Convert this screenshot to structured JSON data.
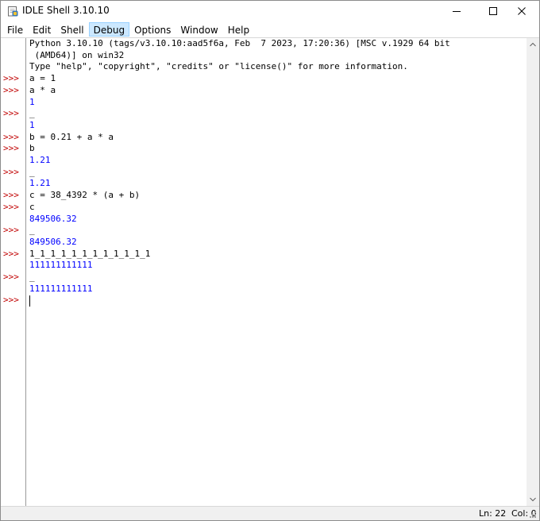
{
  "window": {
    "title": "IDLE Shell 3.10.10",
    "minimize_icon": "minimize-icon",
    "maximize_icon": "maximize-icon",
    "close_icon": "close-icon"
  },
  "menu": {
    "items": [
      {
        "label": "File"
      },
      {
        "label": "Edit"
      },
      {
        "label": "Shell"
      },
      {
        "label": "Debug"
      },
      {
        "label": "Options"
      },
      {
        "label": "Window"
      },
      {
        "label": "Help"
      }
    ],
    "active": "Debug"
  },
  "shell": {
    "prompt": ">>>",
    "banner": [
      "Python 3.10.10 (tags/v3.10.10:aad5f6a, Feb  7 2023, 17:20:36) [MSC v.1929 64 bit",
      " (AMD64)] on win32",
      "Type \"help\", \"copyright\", \"credits\" or \"license()\" for more information."
    ],
    "lines": [
      {
        "kind": "in",
        "text": "a = 1"
      },
      {
        "kind": "in",
        "text": "a * a"
      },
      {
        "kind": "out",
        "text": "1"
      },
      {
        "kind": "in",
        "text": "_"
      },
      {
        "kind": "out",
        "text": "1"
      },
      {
        "kind": "in",
        "text": "b = 0.21 + a * a"
      },
      {
        "kind": "in",
        "text": "b"
      },
      {
        "kind": "out",
        "text": "1.21"
      },
      {
        "kind": "in",
        "text": "_"
      },
      {
        "kind": "out",
        "text": "1.21"
      },
      {
        "kind": "in",
        "text": "c = 38_4392 * (a + b)"
      },
      {
        "kind": "in",
        "text": "c"
      },
      {
        "kind": "out",
        "text": "849506.32"
      },
      {
        "kind": "in",
        "text": "_"
      },
      {
        "kind": "out",
        "text": "849506.32"
      },
      {
        "kind": "in",
        "text": "1_1_1_1_1_1_1_1_1_1_1_1"
      },
      {
        "kind": "out",
        "text": "111111111111"
      },
      {
        "kind": "in",
        "text": "_"
      },
      {
        "kind": "out",
        "text": "111111111111"
      },
      {
        "kind": "in",
        "text": ""
      }
    ]
  },
  "colors": {
    "prompt": "#c00000",
    "output": "#0000ff",
    "input": "#000000",
    "active_menu": "#cce8ff"
  },
  "status": {
    "ln": "Ln: 22",
    "col": "Col: 0"
  }
}
